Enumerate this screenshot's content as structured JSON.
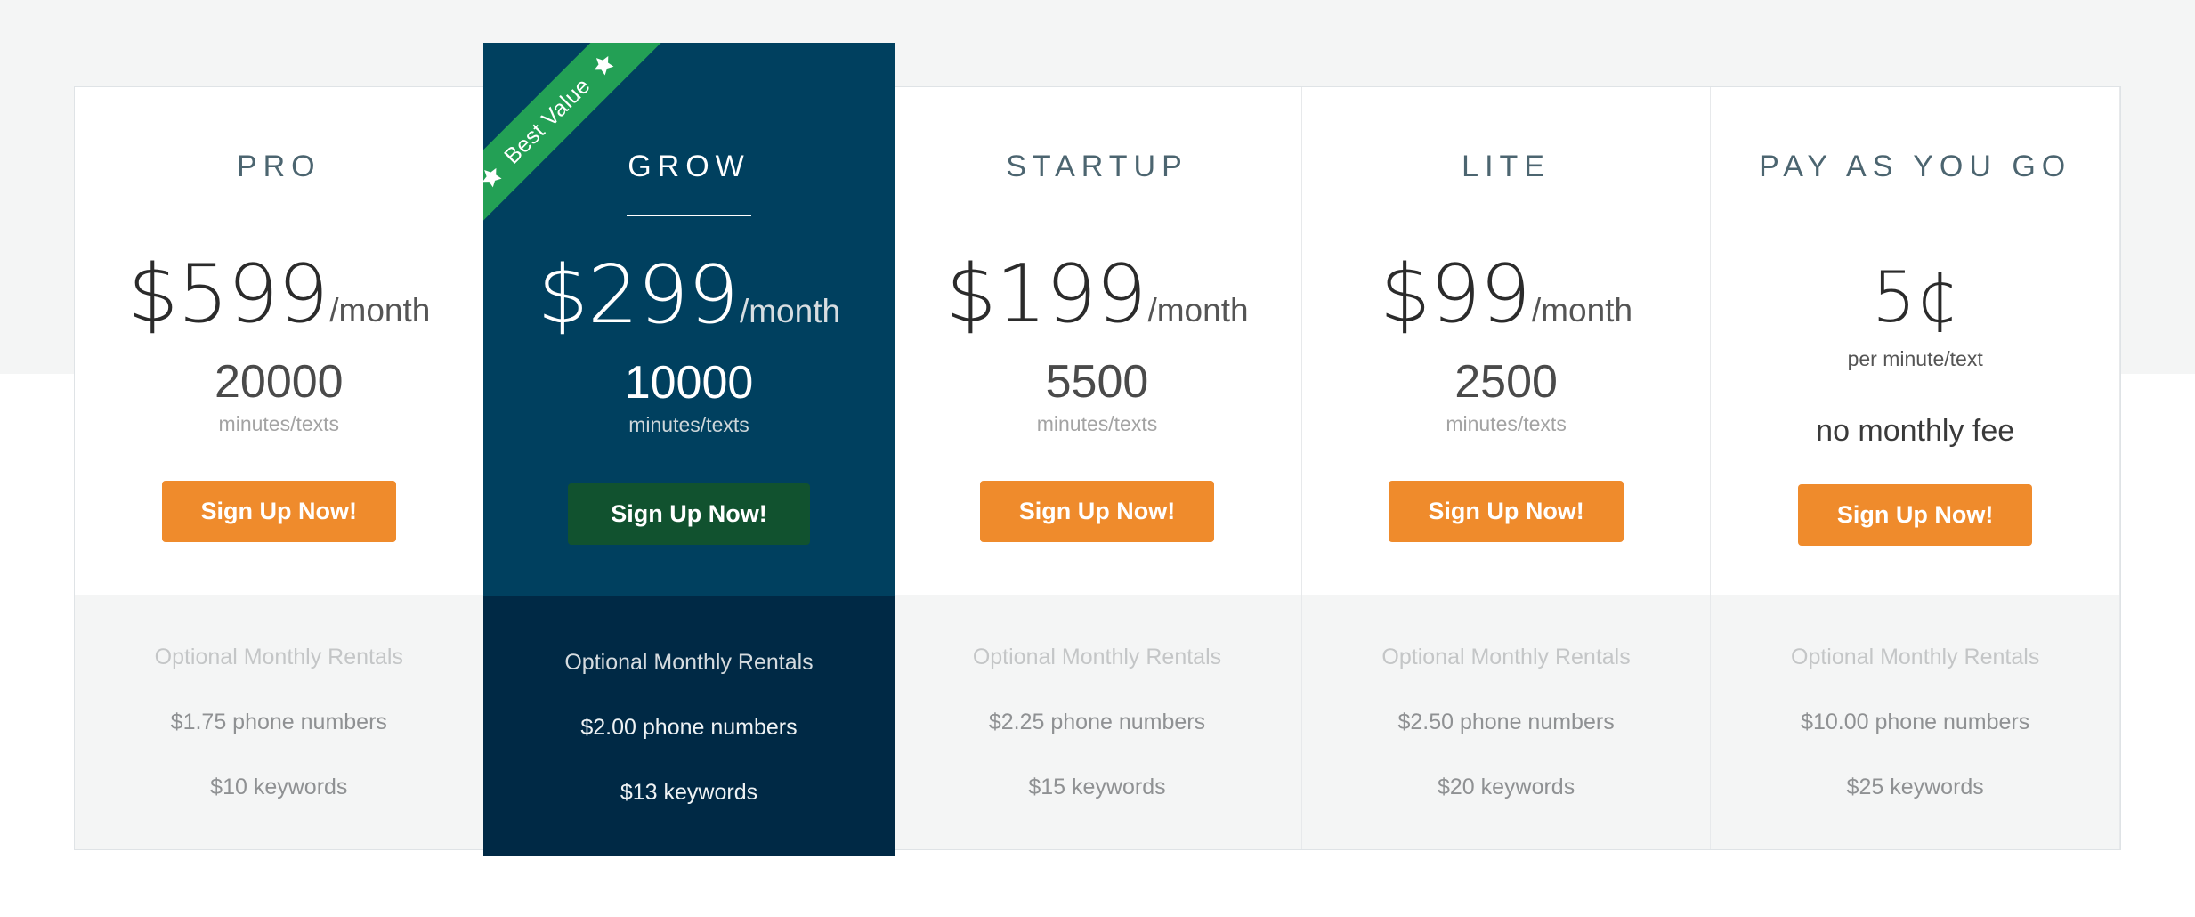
{
  "theme": {
    "page_background": "#ffffff",
    "band_background": "#f4f5f5",
    "card_background": "#ffffff",
    "card_border": "#dfe3e6",
    "footer_background": "#f4f5f5",
    "accent_orange": "#ef8b2c",
    "featured_navy": "#00405f",
    "featured_navy_footer": "#002945",
    "featured_button_green": "#11522f",
    "ribbon_green": "#23a055",
    "plan_name_color": "#4c6570"
  },
  "ribbon": {
    "label": "Best Value",
    "left_icon": "star-icon",
    "right_icon": "star-icon"
  },
  "plans": [
    {
      "id": "pro",
      "name": "PRO",
      "featured": false,
      "price_amount": "$599",
      "price_period": "/month",
      "quota": "20000",
      "quota_unit": "minutes/texts",
      "cta_label": "Sign Up Now!",
      "rentals_title": "Optional Monthly Rentals",
      "rentals": [
        "$1.75 phone numbers",
        "$10 keywords"
      ]
    },
    {
      "id": "grow",
      "name": "GROW",
      "featured": true,
      "price_amount": "$299",
      "price_period": "/month",
      "quota": "10000",
      "quota_unit": "minutes/texts",
      "cta_label": "Sign Up Now!",
      "rentals_title": "Optional Monthly Rentals",
      "rentals": [
        "$2.00 phone numbers",
        "$13 keywords"
      ]
    },
    {
      "id": "startup",
      "name": "STARTUP",
      "featured": false,
      "price_amount": "$199",
      "price_period": "/month",
      "quota": "5500",
      "quota_unit": "minutes/texts",
      "cta_label": "Sign Up Now!",
      "rentals_title": "Optional Monthly Rentals",
      "rentals": [
        "$2.25 phone numbers",
        "$15 keywords"
      ]
    },
    {
      "id": "lite",
      "name": "LITE",
      "featured": false,
      "price_amount": "$99",
      "price_period": "/month",
      "quota": "2500",
      "quota_unit": "minutes/texts",
      "cta_label": "Sign Up Now!",
      "rentals_title": "Optional Monthly Rentals",
      "rentals": [
        "$2.50 phone numbers",
        "$20 keywords"
      ]
    },
    {
      "id": "payg",
      "name": "PAY AS YOU GO",
      "featured": false,
      "pay_as_you_go": true,
      "price_amount": "5¢",
      "price_period": "",
      "price_sub": "per minute/text",
      "quota": "",
      "quota_unit": "",
      "note": "no monthly fee",
      "cta_label": "Sign Up Now!",
      "rentals_title": "Optional Monthly Rentals",
      "rentals": [
        "$10.00 phone numbers",
        "$25 keywords"
      ]
    }
  ]
}
